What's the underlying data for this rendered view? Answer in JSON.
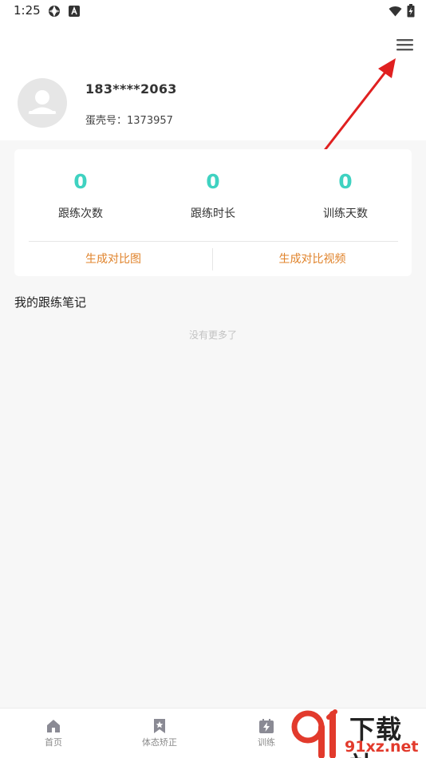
{
  "status_bar": {
    "time": "1:25"
  },
  "header": {
    "phone": "183****2063",
    "egg_id_label": "蛋壳号：",
    "egg_id_value": "1373957"
  },
  "stats": [
    {
      "value": "0",
      "label": "跟练次数"
    },
    {
      "value": "0",
      "label": "跟练时长"
    },
    {
      "value": "0",
      "label": "训练天数"
    }
  ],
  "actions": {
    "compare_image": "生成对比图",
    "compare_video": "生成对比视频"
  },
  "notes": {
    "title": "我的跟练笔记",
    "empty_text": "没有更多了"
  },
  "bottom_nav": [
    {
      "label": "首页",
      "icon": "home-icon"
    },
    {
      "label": "体态矫正",
      "icon": "bookmark-star-icon"
    },
    {
      "label": "训练",
      "icon": "training-bolt-icon"
    }
  ],
  "watermark": {
    "text": "下载站",
    "url": "91xz.net"
  },
  "colors": {
    "accent_teal": "#3fd2c1",
    "action_orange": "#e0832b",
    "annotation_red": "#e02020"
  }
}
